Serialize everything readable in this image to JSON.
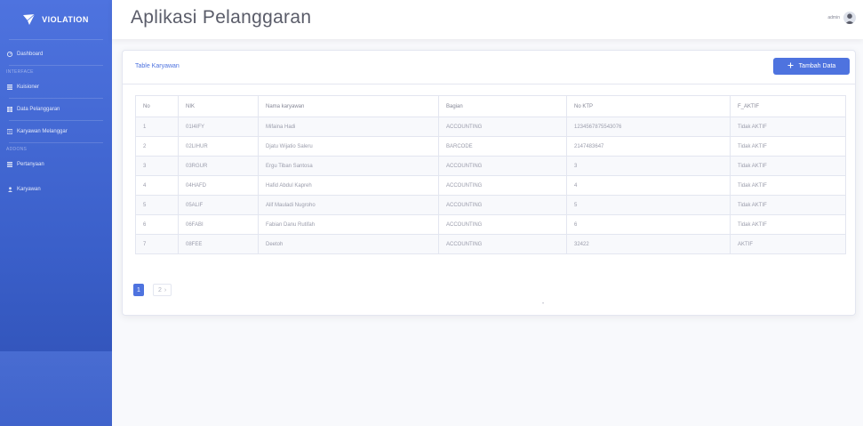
{
  "brand": {
    "name": "VIOLATION",
    "logo_icon": "paper-plane-icon"
  },
  "sidebar": {
    "items": [
      {
        "label": "Dashboard",
        "icon": "dashboard-icon"
      },
      {
        "heading": "INTERFACE"
      },
      {
        "label": "Kuisioner",
        "icon": "list-icon"
      },
      {
        "label": "Data Pelanggaran",
        "icon": "table-icon"
      },
      {
        "label": "Karyawan Melanggar",
        "icon": "user-list-icon"
      },
      {
        "heading": "ADDONS"
      },
      {
        "label": "Pertanyaan",
        "icon": "question-icon"
      },
      {
        "label": "Karyawan",
        "icon": "users-icon"
      }
    ]
  },
  "topbar": {
    "title": "Aplikasi Pelanggaran",
    "user_name": "admin"
  },
  "card": {
    "title": "Table Karyawan",
    "add_button": "Tambah Data",
    "columns": [
      "No",
      "NIK",
      "Nama karyawan",
      "Bagian",
      "No KTP",
      "F_AKTIF"
    ],
    "rows": [
      [
        "1",
        "01I4IFY",
        "Mifaina Hadi",
        "ACCOUNTING",
        "1234567875543076",
        "Tidak AKTIF"
      ],
      [
        "2",
        "02LIHUR",
        "Djatu Wijatio Saleru",
        "BARCODE",
        "2147483647",
        "Tidak AKTIF"
      ],
      [
        "3",
        "03RGUR",
        "Ergu Tiban Santosa",
        "ACCOUNTING",
        "3",
        "Tidak AKTIF"
      ],
      [
        "4",
        "04HAFD",
        "Hafid Abdul Kapreh",
        "ACCOUNTING",
        "4",
        "Tidak AKTIF"
      ],
      [
        "5",
        "05ALIF",
        "Alif Mauladi Nugroho",
        "ACCOUNTING",
        "5",
        "Tidak AKTIF"
      ],
      [
        "6",
        "06FABI",
        "Fabian Danu Rutifah",
        "ACCOUNTING",
        "6",
        "Tidak AKTIF"
      ],
      [
        "7",
        "08FEE",
        "Deetoh",
        "ACCOUNTING",
        "32422",
        "AKTIF"
      ]
    ],
    "pagination": {
      "active": "1",
      "next_page": "2",
      "next_arrow": "›"
    }
  },
  "colors": {
    "primary": "#4e73df",
    "sidebar_dark": "#2e4fb3",
    "text": "#858796"
  }
}
